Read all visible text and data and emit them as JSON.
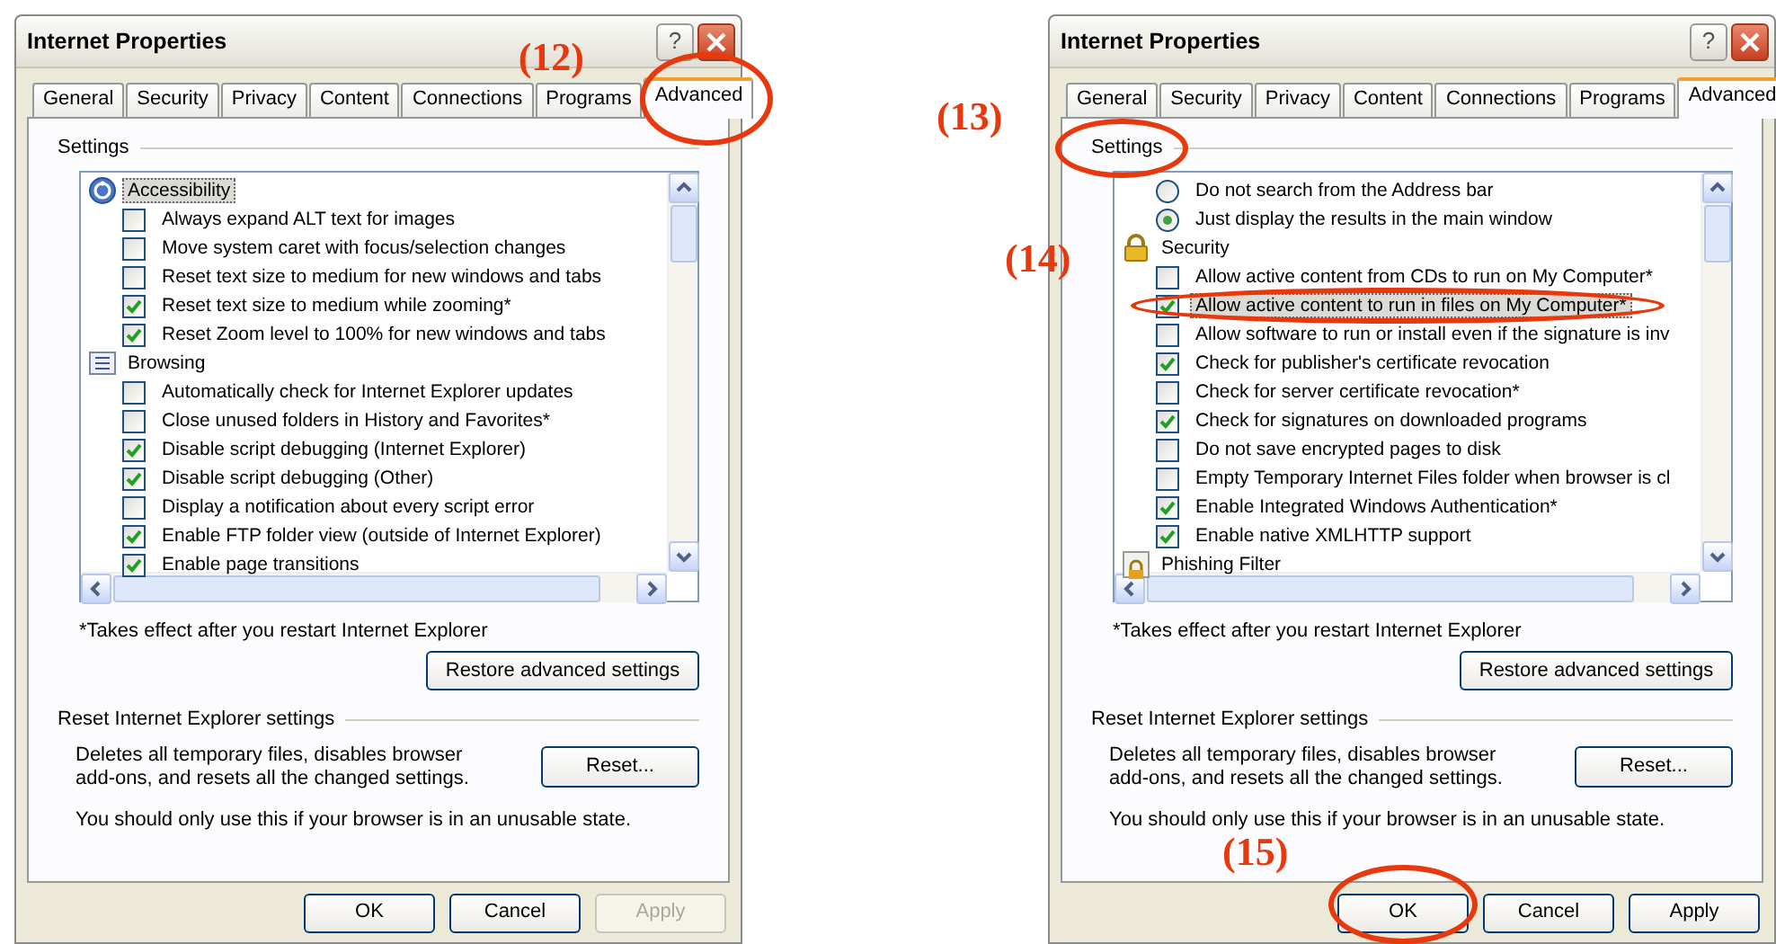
{
  "dialogs": [
    {
      "title": "Internet Properties",
      "help_button": "?",
      "tabs": [
        {
          "label": "General",
          "selected": false
        },
        {
          "label": "Security",
          "selected": false
        },
        {
          "label": "Privacy",
          "selected": false
        },
        {
          "label": "Content",
          "selected": false
        },
        {
          "label": "Connections",
          "selected": false
        },
        {
          "label": "Programs",
          "selected": false
        },
        {
          "label": "Advanced",
          "selected": true,
          "annotation": "(12)"
        }
      ],
      "settings_label": "Settings",
      "settings_items": [
        {
          "kind": "category",
          "label": "Accessibility",
          "selected": true
        },
        {
          "kind": "checkbox",
          "label": "Always expand ALT text for images",
          "checked": false,
          "selected": false
        },
        {
          "kind": "checkbox",
          "label": "Move system caret with focus/selection changes",
          "checked": false,
          "selected": false
        },
        {
          "kind": "checkbox",
          "label": "Reset text size to medium for new windows and tabs",
          "checked": false,
          "selected": false
        },
        {
          "kind": "checkbox",
          "label": "Reset text size to medium while zooming*",
          "checked": true,
          "selected": false
        },
        {
          "kind": "checkbox",
          "label": "Reset Zoom level to 100% for new windows and tabs",
          "checked": true,
          "selected": false
        },
        {
          "kind": "category",
          "label": "Browsing",
          "selected": false
        },
        {
          "kind": "checkbox",
          "label": "Automatically check for Internet Explorer updates",
          "checked": false,
          "selected": false
        },
        {
          "kind": "checkbox",
          "label": "Close unused folders in History and Favorites*",
          "checked": false,
          "selected": false
        },
        {
          "kind": "checkbox",
          "label": "Disable script debugging (Internet Explorer)",
          "checked": true,
          "selected": false
        },
        {
          "kind": "checkbox",
          "label": "Disable script debugging (Other)",
          "checked": true,
          "selected": false
        },
        {
          "kind": "checkbox",
          "label": "Display a notification about every script error",
          "checked": false,
          "selected": false
        },
        {
          "kind": "checkbox",
          "label": "Enable FTP folder view (outside of Internet Explorer)",
          "checked": true,
          "selected": false
        },
        {
          "kind": "checkbox",
          "label": "Enable page transitions",
          "checked": true,
          "selected": false
        }
      ],
      "note": "*Takes effect after you restart Internet Explorer",
      "restore_button": "Restore advanced settings",
      "reset_group_label": "Reset Internet Explorer settings",
      "reset_description": "Deletes all temporary files, disables browser add-ons, and resets all the changed settings.",
      "reset_button": "Reset...",
      "reset_warning": "You should only use this if your browser is in an unusable state.",
      "buttons": [
        {
          "label": "OK",
          "disabled": false
        },
        {
          "label": "Cancel",
          "disabled": false
        },
        {
          "label": "Apply",
          "disabled": true
        }
      ]
    },
    {
      "title": "Internet Properties",
      "help_button": "?",
      "tabs": [
        {
          "label": "General",
          "selected": false
        },
        {
          "label": "Security",
          "selected": false
        },
        {
          "label": "Privacy",
          "selected": false
        },
        {
          "label": "Content",
          "selected": false
        },
        {
          "label": "Connections",
          "selected": false
        },
        {
          "label": "Programs",
          "selected": false
        },
        {
          "label": "Advanced",
          "selected": true
        }
      ],
      "settings_label": "Settings",
      "settings_annotation": "(13)",
      "settings_items": [
        {
          "kind": "radio",
          "label": "Do not search from the Address bar",
          "checked": false,
          "selected": false
        },
        {
          "kind": "radio",
          "label": "Just display the results in the main window",
          "checked": true,
          "selected": false
        },
        {
          "kind": "category",
          "label": "Security",
          "selected": false
        },
        {
          "kind": "checkbox",
          "label": "Allow active content from CDs to run on My Computer*",
          "checked": false,
          "selected": false
        },
        {
          "kind": "checkbox",
          "label": "Allow active content to run in files on My Computer*",
          "checked": true,
          "selected": true,
          "annotation": "(14)"
        },
        {
          "kind": "checkbox",
          "label": "Allow software to run or install even if the signature is inv",
          "checked": false,
          "selected": false
        },
        {
          "kind": "checkbox",
          "label": "Check for publisher's certificate revocation",
          "checked": true,
          "selected": false
        },
        {
          "kind": "checkbox",
          "label": "Check for server certificate revocation*",
          "checked": false,
          "selected": false
        },
        {
          "kind": "checkbox",
          "label": "Check for signatures on downloaded programs",
          "checked": true,
          "selected": false
        },
        {
          "kind": "checkbox",
          "label": "Do not save encrypted pages to disk",
          "checked": false,
          "selected": false
        },
        {
          "kind": "checkbox",
          "label": "Empty Temporary Internet Files folder when browser is cl",
          "checked": false,
          "selected": false
        },
        {
          "kind": "checkbox",
          "label": "Enable Integrated Windows Authentication*",
          "checked": true,
          "selected": false
        },
        {
          "kind": "checkbox",
          "label": "Enable native XMLHTTP support",
          "checked": true,
          "selected": false
        },
        {
          "kind": "category",
          "label": "Phishing Filter",
          "selected": false
        }
      ],
      "note": "*Takes effect after you restart Internet Explorer",
      "restore_button": "Restore advanced settings",
      "reset_group_label": "Reset Internet Explorer settings",
      "reset_description": "Deletes all temporary files, disables browser add-ons, and resets all the changed settings.",
      "reset_button": "Reset...",
      "reset_warning": "You should only use this if your browser is in an unusable state.",
      "buttons": [
        {
          "label": "OK",
          "disabled": false,
          "annotation": "(15)"
        },
        {
          "label": "Cancel",
          "disabled": false
        },
        {
          "label": "Apply",
          "disabled": false
        }
      ]
    }
  ]
}
